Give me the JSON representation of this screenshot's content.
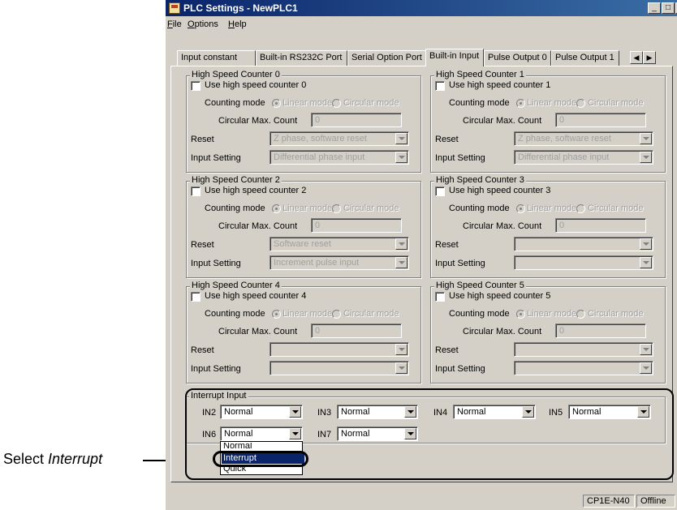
{
  "window": {
    "title": "PLC Settings - NewPLC1"
  },
  "menu": [
    {
      "label": "File",
      "u": "F",
      "rest": "ile"
    },
    {
      "label": "Options",
      "u": "O",
      "rest": "ptions"
    },
    {
      "label": "Help",
      "u": "H",
      "rest": "elp"
    }
  ],
  "tabs": [
    "Input constant",
    "Built-in RS232C Port",
    "Serial Option Port",
    "Built-in Input",
    "Pulse Output 0",
    "Pulse Output 1"
  ],
  "active_tab": "Built-in Input",
  "counters": [
    {
      "title": "High Speed Counter 0",
      "use_label": "Use high speed counter 0",
      "counting_mode": "Counting mode",
      "linear": "Linear mode",
      "circular": "Circular mode",
      "max_label": "Circular Max. Count",
      "max_value": "0",
      "reset_label": "Reset",
      "reset_value": "Z phase, software reset",
      "input_label": "Input Setting",
      "input_value": "Differential phase input"
    },
    {
      "title": "High Speed Counter 1",
      "use_label": "Use high speed counter 1",
      "counting_mode": "Counting mode",
      "linear": "Linear mode",
      "circular": "Circular mode",
      "max_label": "Circular Max. Count",
      "max_value": "0",
      "reset_label": "Reset",
      "reset_value": "Z phase, software reset",
      "input_label": "Input Setting",
      "input_value": "Differential phase input"
    },
    {
      "title": "High Speed Counter 2",
      "use_label": "Use high speed counter 2",
      "counting_mode": "Counting mode",
      "linear": "Linear mode",
      "circular": "Circular mode",
      "max_label": "Circular Max. Count",
      "max_value": "0",
      "reset_label": "Reset",
      "reset_value": "Software reset",
      "input_label": "Input Setting",
      "input_value": "Increment pulse input"
    },
    {
      "title": "High Speed Counter 3",
      "use_label": "Use high speed counter 3",
      "counting_mode": "Counting mode",
      "linear": "Linear mode",
      "circular": "Circular mode",
      "max_label": "Circular Max. Count",
      "max_value": "0",
      "reset_label": "Reset",
      "reset_value": "",
      "input_label": "Input Setting",
      "input_value": ""
    },
    {
      "title": "High Speed Counter 4",
      "use_label": "Use high speed counter 4",
      "counting_mode": "Counting mode",
      "linear": "Linear mode",
      "circular": "Circular mode",
      "max_label": "Circular Max. Count",
      "max_value": "0",
      "reset_label": "Reset",
      "reset_value": "",
      "input_label": "Input Setting",
      "input_value": ""
    },
    {
      "title": "High Speed Counter 5",
      "use_label": "Use high speed counter 5",
      "counting_mode": "Counting mode",
      "linear": "Linear mode",
      "circular": "Circular mode",
      "max_label": "Circular Max. Count",
      "max_value": "0",
      "reset_label": "Reset",
      "reset_value": "",
      "input_label": "Input Setting",
      "input_value": ""
    }
  ],
  "interrupt": {
    "title": "Interrupt Input",
    "inputs": [
      {
        "label": "IN2",
        "value": "Normal"
      },
      {
        "label": "IN3",
        "value": "Normal"
      },
      {
        "label": "IN4",
        "value": "Normal"
      },
      {
        "label": "IN5",
        "value": "Normal"
      },
      {
        "label": "IN6",
        "value": "Normal"
      },
      {
        "label": "IN7",
        "value": "Normal"
      }
    ],
    "dropdown_options": [
      "Normal",
      "Interrupt",
      "Quick"
    ],
    "dropdown_selected": "Interrupt"
  },
  "status": {
    "model": "CP1E-N40",
    "mode": "Offline"
  },
  "annotation": {
    "prefix": "Select ",
    "emph": "Interrupt"
  }
}
